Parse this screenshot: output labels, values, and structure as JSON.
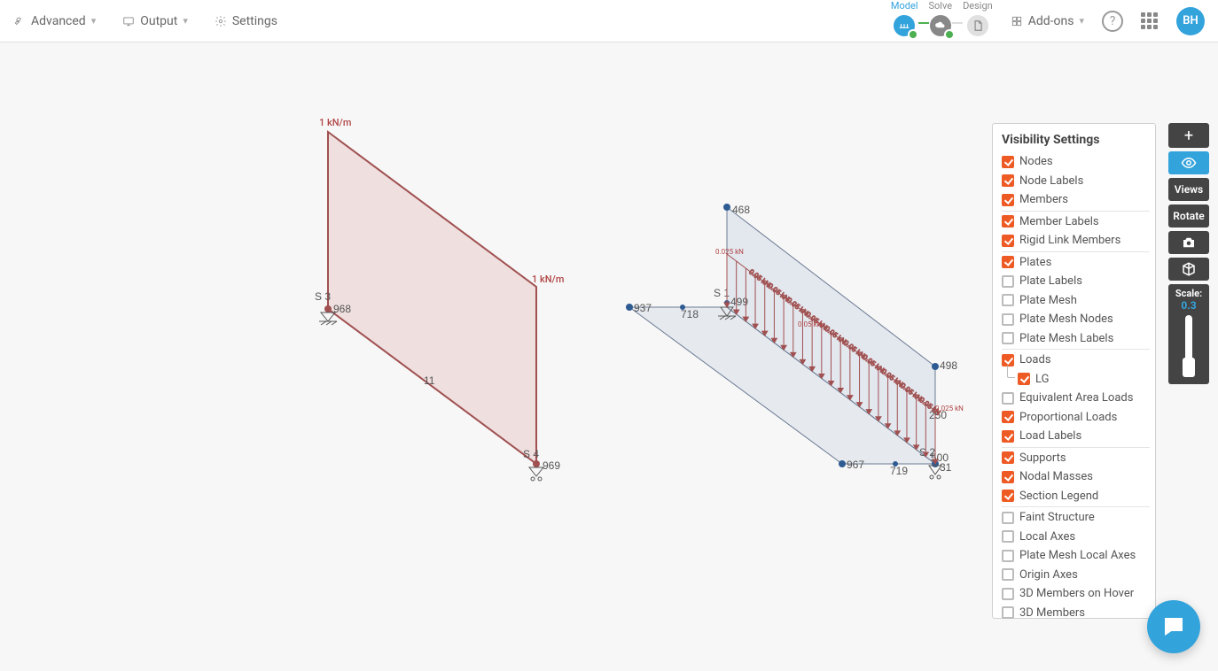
{
  "toolbar": {
    "advanced": "Advanced",
    "output": "Output",
    "settings": "Settings",
    "addons": "Add-ons"
  },
  "steps": {
    "model": "Model",
    "solve": "Solve",
    "design": "Design"
  },
  "avatar": "BH",
  "rightTools": {
    "plus": "+",
    "views": "Views",
    "rotate": "Rotate",
    "scaleLabel": "Scale:",
    "scaleValue": "0.3"
  },
  "visPanel": {
    "title": "Visibility Settings",
    "items": [
      {
        "label": "Nodes",
        "on": true
      },
      {
        "label": "Node Labels",
        "on": true
      },
      {
        "label": "Members",
        "on": true,
        "sep": true
      },
      {
        "label": "Member Labels",
        "on": true
      },
      {
        "label": "Rigid Link Members",
        "on": true,
        "sep": true
      },
      {
        "label": "Plates",
        "on": true
      },
      {
        "label": "Plate Labels",
        "on": false
      },
      {
        "label": "Plate Mesh",
        "on": false
      },
      {
        "label": "Plate Mesh Nodes",
        "on": false
      },
      {
        "label": "Plate Mesh Labels",
        "on": false,
        "sep": true
      },
      {
        "label": "Loads",
        "on": true
      },
      {
        "label": "LG",
        "on": true,
        "indent": true
      },
      {
        "label": "Equivalent Area Loads",
        "on": false
      },
      {
        "label": "Proportional Loads",
        "on": true
      },
      {
        "label": "Load Labels",
        "on": true,
        "sep": true
      },
      {
        "label": "Supports",
        "on": true
      },
      {
        "label": "Nodal Masses",
        "on": true
      },
      {
        "label": "Section Legend",
        "on": true,
        "sep": true
      },
      {
        "label": "Faint Structure",
        "on": false
      },
      {
        "label": "Local Axes",
        "on": false
      },
      {
        "label": "Plate Mesh Local Axes",
        "on": false
      },
      {
        "label": "Origin Axes",
        "on": false
      },
      {
        "label": "3D Members on Hover",
        "on": false
      },
      {
        "label": "3D Members",
        "on": false
      }
    ]
  },
  "modelLeft": {
    "loadTop": "1 kN/m",
    "loadRight": "1 kN/m",
    "s3": "S 3",
    "n968": "968",
    "s4": "S 4",
    "n969": "969",
    "mem": "11"
  },
  "modelRight": {
    "n468": "468",
    "n498": "498",
    "n937": "937",
    "n718": "718",
    "n967": "967",
    "n719": "719",
    "n499": "499",
    "n500": "500",
    "n250": "250",
    "n31": "31",
    "s1": "S 1",
    "s2": "S 2",
    "loadTop": "0.025 kN",
    "loadMid": "0.05 kN",
    "loadBot": "0.025 kN"
  }
}
